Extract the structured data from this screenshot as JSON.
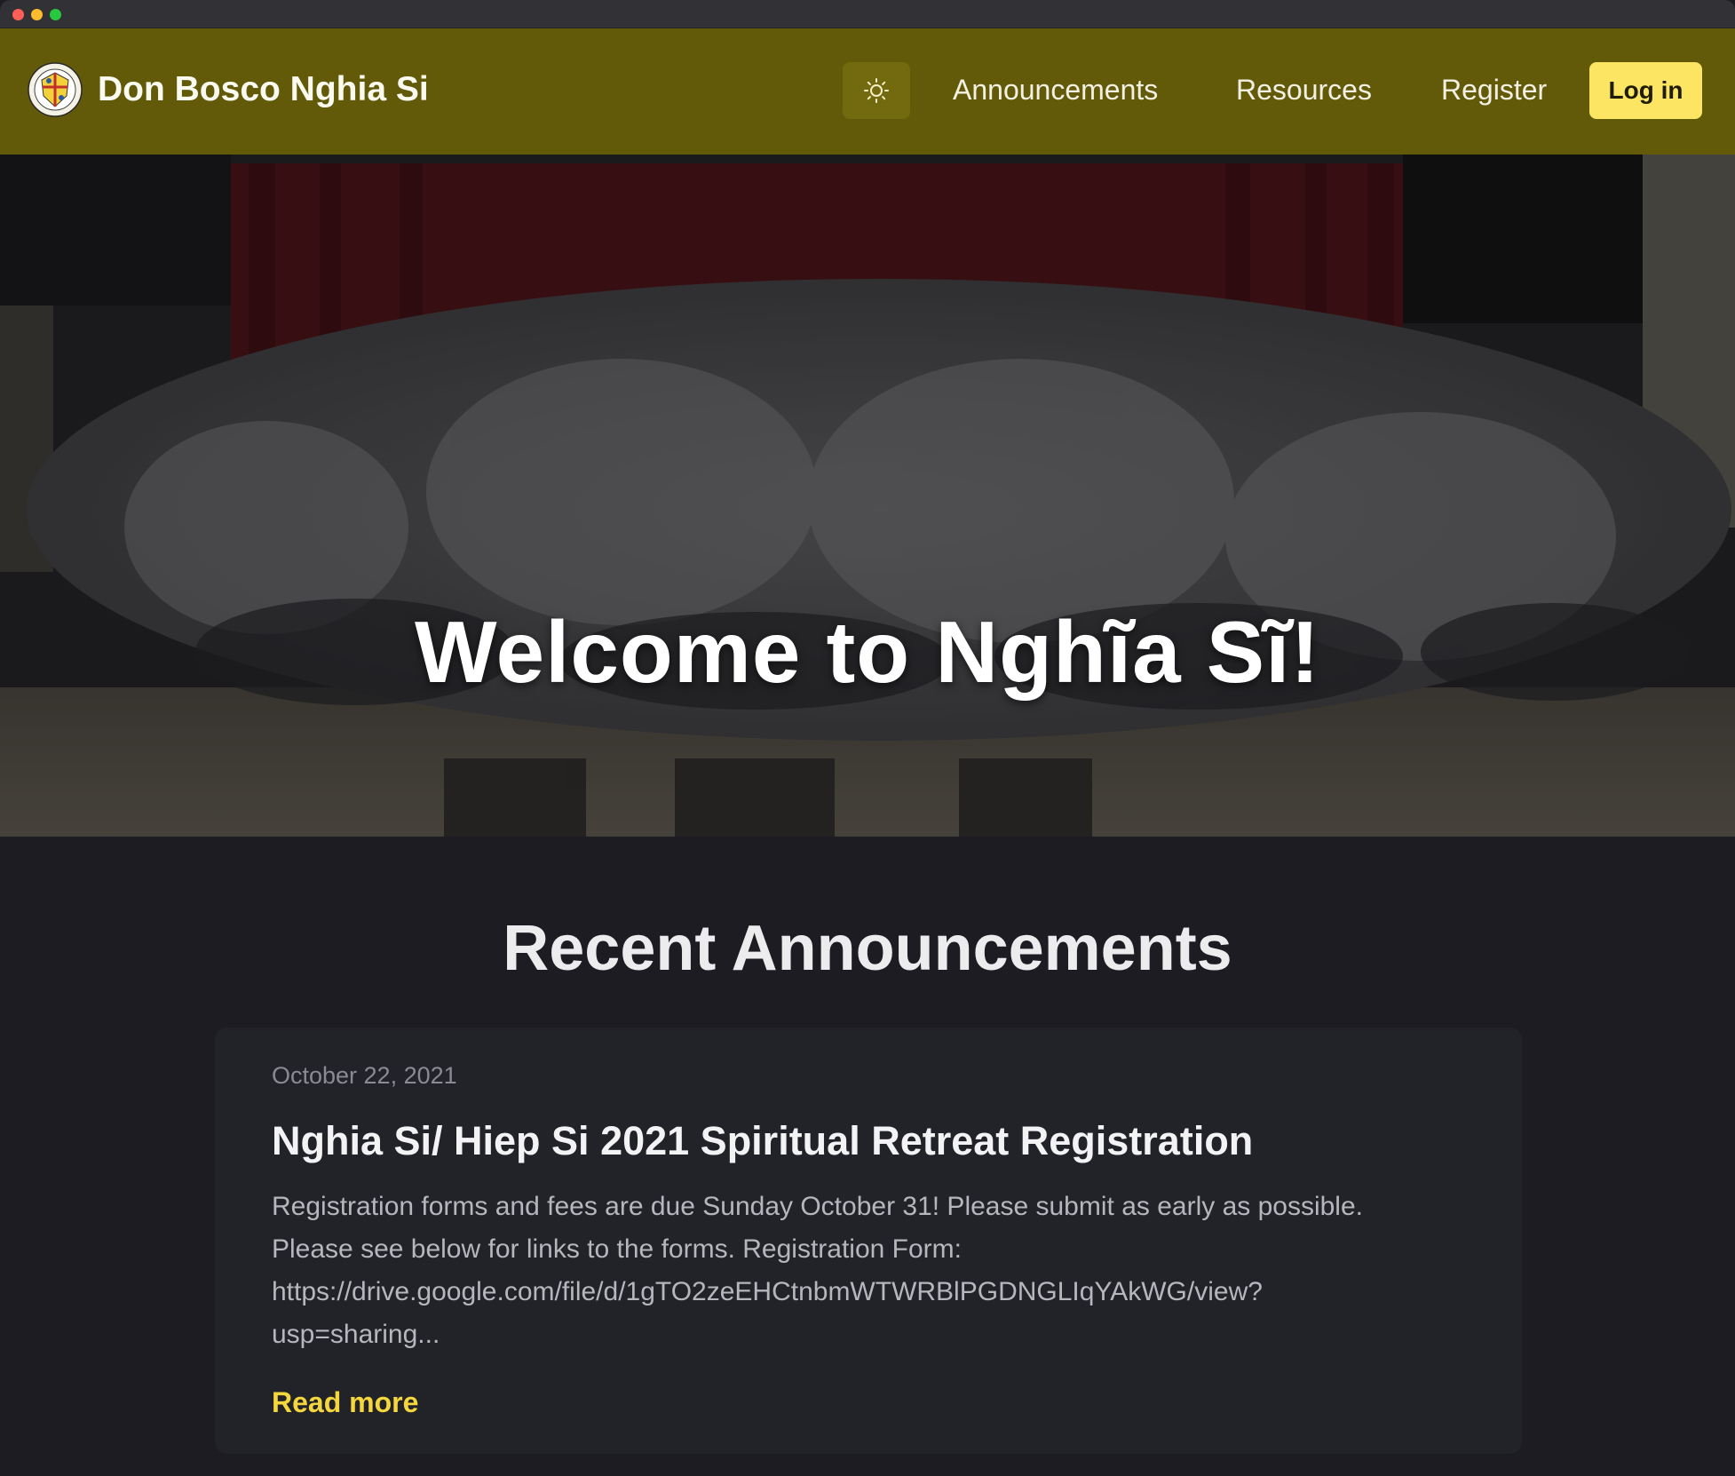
{
  "navbar": {
    "brand_name": "Don Bosco Nghia Si",
    "logo_icon": "crest-logo-icon",
    "theme_toggle_icon": "sun-icon",
    "links": [
      "Announcements",
      "Resources",
      "Register"
    ],
    "login_label": "Log in",
    "colors": {
      "background": "#635a09",
      "login": "#fce563"
    }
  },
  "hero": {
    "title": "Welcome to Nghĩa Sĩ!",
    "image_icon": "group-photo-image"
  },
  "announcements": {
    "section_title": "Recent Announcements",
    "items": [
      {
        "date": "October 22, 2021",
        "title": "Nghia Si/ Hiep Si 2021 Spiritual Retreat Registration",
        "excerpt_lines": [
          "Registration forms and fees are due Sunday October 31! Please submit as early as possible.",
          "Please see below for links to the forms.   Registration Form:",
          "https://drive.google.com/file/d/1gTO2zeEHCtnbmWTWRBlPGDNGLIqYAkWG/view?",
          "usp=sharing..."
        ],
        "read_more": "Read more"
      }
    ],
    "colors": {
      "link": "#f4d73c"
    }
  }
}
